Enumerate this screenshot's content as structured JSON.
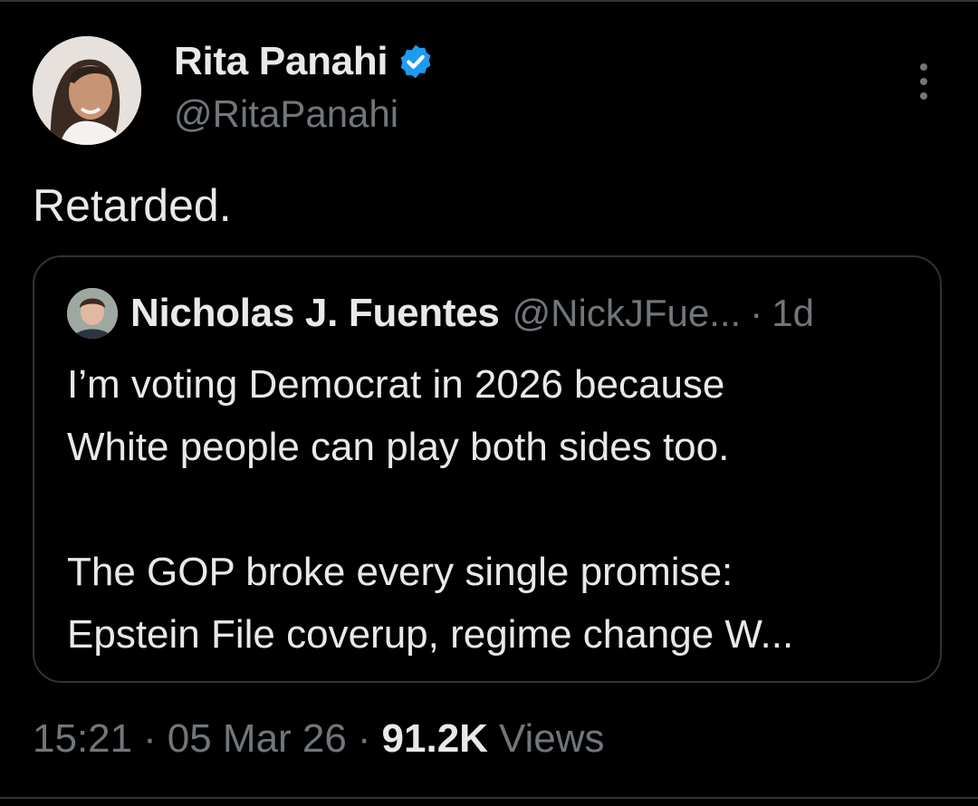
{
  "author": {
    "display_name": "Rita Panahi",
    "handle": "@RitaPanahi",
    "avatar": "profile-photo",
    "verified_icon": "verified-badge-icon"
  },
  "tweet": {
    "text": "Retarded."
  },
  "quoted_tweet": {
    "display_name": "Nicholas J. Fuentes",
    "handle": "@NickJFue...",
    "separator": "·",
    "time": "1d",
    "lines": [
      "I’m voting Democrat in 2026 because",
      "White people can play both sides too.",
      "",
      "The GOP broke every single promise:",
      "Epstein File coverup, regime change W..."
    ]
  },
  "meta": {
    "time": "15:21",
    "date": "05 Mar 26",
    "separator": "·",
    "views_count": "91.2K",
    "views_label": "Views"
  },
  "colors": {
    "background": "#000000",
    "text_primary": "#e7e9ea",
    "text_secondary": "#71767b",
    "border": "#2f3336",
    "verified": "#1d9bf0"
  },
  "icons": {
    "more": "more-vertical-icon"
  }
}
